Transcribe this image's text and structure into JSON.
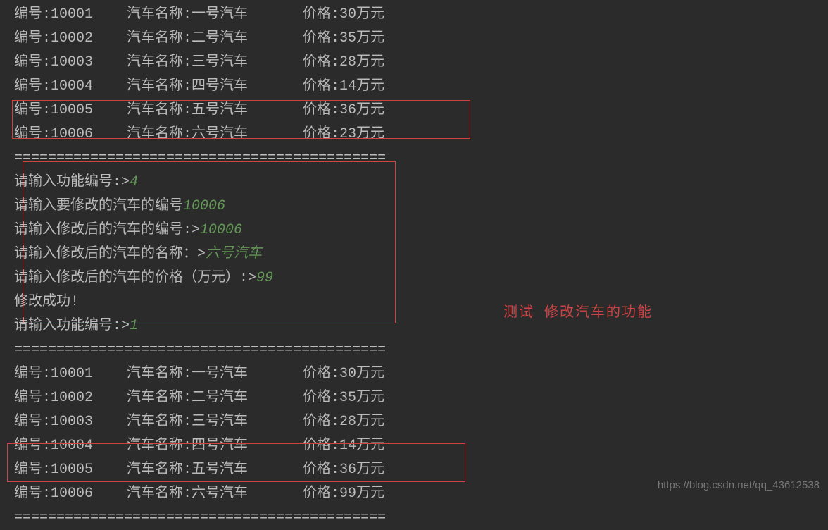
{
  "labels": {
    "id_prefix": "编号:",
    "name_prefix": "汽车名称:",
    "price_prefix": "价格:",
    "price_suffix": "万元",
    "separator": "============================================"
  },
  "cars_before": [
    {
      "id": "10001",
      "name": "一号汽车",
      "price": "30"
    },
    {
      "id": "10002",
      "name": "二号汽车",
      "price": "35"
    },
    {
      "id": "10003",
      "name": "三号汽车",
      "price": "28"
    },
    {
      "id": "10004",
      "name": "四号汽车",
      "price": "14"
    },
    {
      "id": "10005",
      "name": "五号汽车",
      "price": "36"
    },
    {
      "id": "10006",
      "name": "六号汽车",
      "price": "23"
    }
  ],
  "prompts": {
    "func_num": "请输入功能编号:>",
    "func_num_val1": "4",
    "edit_id": "请输入要修改的汽车的编号",
    "edit_id_val": "10006",
    "new_id": "请输入修改后的汽车的编号:>",
    "new_id_val": "10006",
    "new_name": "请输入修改后的汽车的名称：>",
    "new_name_val": "六号汽车",
    "new_price": "请输入修改后的汽车的价格（万元）:>",
    "new_price_val": "99",
    "success": "修改成功!",
    "func_num_val2": "1"
  },
  "cars_after": [
    {
      "id": "10001",
      "name": "一号汽车",
      "price": "30"
    },
    {
      "id": "10002",
      "name": "二号汽车",
      "price": "35"
    },
    {
      "id": "10003",
      "name": "三号汽车",
      "price": "28"
    },
    {
      "id": "10004",
      "name": "四号汽车",
      "price": "14"
    },
    {
      "id": "10005",
      "name": "五号汽车",
      "price": "36"
    },
    {
      "id": "10006",
      "name": "六号汽车",
      "price": "99"
    }
  ],
  "annotation": "测试  修改汽车的功能",
  "watermark": "https://blog.csdn.net/qq_43612538"
}
